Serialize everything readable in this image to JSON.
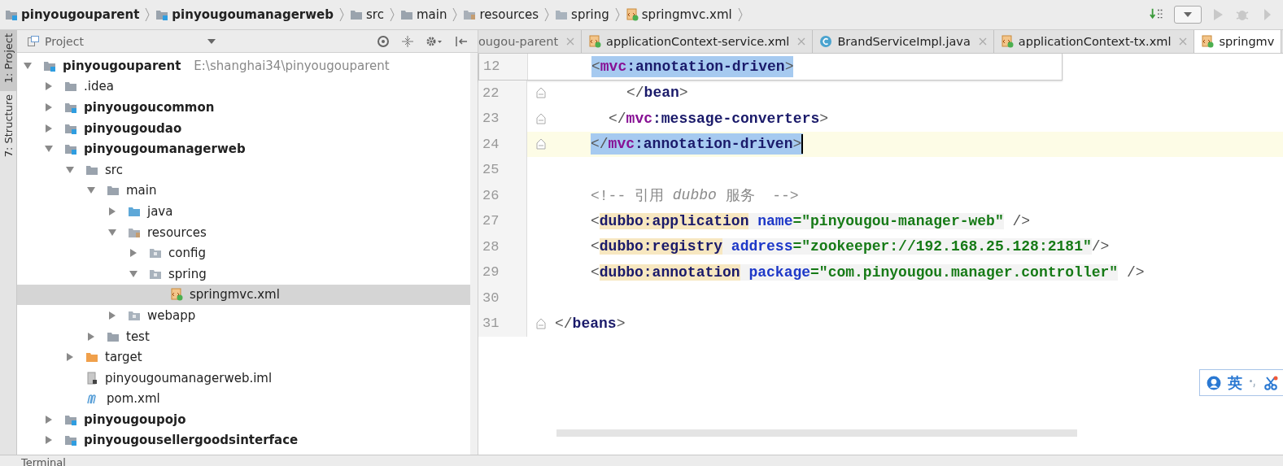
{
  "breadcrumb": [
    {
      "label": "pinyougouparent",
      "kind": "module"
    },
    {
      "label": "pinyougoumanagerweb",
      "kind": "module"
    },
    {
      "label": "src",
      "kind": "folder"
    },
    {
      "label": "main",
      "kind": "folder"
    },
    {
      "label": "resources",
      "kind": "resources"
    },
    {
      "label": "spring",
      "kind": "package"
    },
    {
      "label": "springmvc.xml",
      "kind": "xml"
    }
  ],
  "side_tabs": [
    {
      "label": "1: Project",
      "selected": true
    },
    {
      "label": "7: Structure",
      "selected": false
    }
  ],
  "project_panel": {
    "title": "Project"
  },
  "tree": [
    {
      "label": "pinyougouparent",
      "path": "E:\\shanghai34\\pinyougouparent",
      "kind": "module",
      "expanded": true,
      "selected": false,
      "children": [
        {
          "label": ".idea",
          "kind": "folder",
          "expanded": false,
          "selected": false
        },
        {
          "label": "pinyougoucommon",
          "kind": "module",
          "expanded": false,
          "selected": false
        },
        {
          "label": "pinyougoudao",
          "kind": "module",
          "expanded": false,
          "selected": false
        },
        {
          "label": "pinyougoumanagerweb",
          "kind": "module",
          "expanded": true,
          "selected": false,
          "children": [
            {
              "label": "src",
              "kind": "folder",
              "expanded": true,
              "selected": false,
              "children": [
                {
                  "label": "main",
                  "kind": "folder",
                  "expanded": true,
                  "selected": false,
                  "children": [
                    {
                      "label": "java",
                      "kind": "source",
                      "expanded": false,
                      "selected": false
                    },
                    {
                      "label": "resources",
                      "kind": "resources",
                      "expanded": true,
                      "selected": false,
                      "children": [
                        {
                          "label": "config",
                          "kind": "package",
                          "expanded": false,
                          "selected": false
                        },
                        {
                          "label": "spring",
                          "kind": "package",
                          "expanded": true,
                          "selected": false,
                          "children": [
                            {
                              "label": "springmvc.xml",
                              "kind": "xml",
                              "selected": true
                            }
                          ]
                        }
                      ]
                    },
                    {
                      "label": "webapp",
                      "kind": "web",
                      "expanded": false,
                      "selected": false
                    }
                  ]
                },
                {
                  "label": "test",
                  "kind": "folder",
                  "expanded": false,
                  "selected": false
                }
              ]
            },
            {
              "label": "target",
              "kind": "excluded",
              "expanded": false,
              "selected": false
            },
            {
              "label": "pinyougoumanagerweb.iml",
              "kind": "iml",
              "selected": false
            },
            {
              "label": "pom.xml",
              "kind": "maven",
              "selected": false
            }
          ]
        },
        {
          "label": "pinyougoupojo",
          "kind": "module",
          "expanded": false,
          "selected": false
        },
        {
          "label": "pinyougousellergoodsinterface",
          "kind": "module",
          "expanded": false,
          "selected": false
        }
      ]
    }
  ],
  "tabs": [
    {
      "label": "ougou-parent",
      "selected": false
    },
    {
      "label": "applicationContext-service.xml",
      "kind": "xml",
      "selected": false
    },
    {
      "label": "BrandServiceImpl.java",
      "kind": "class",
      "selected": false
    },
    {
      "label": "applicationContext-tx.xml",
      "kind": "xml",
      "selected": false
    },
    {
      "label": "springmv",
      "kind": "xml",
      "selected": true
    }
  ],
  "sticky_line": {
    "number": "12",
    "kind": "selection",
    "tokens": [
      {
        "text": "<",
        "kind": "bracket"
      },
      {
        "text": "mvc",
        "kind": "ns"
      },
      {
        "text": ":annotation-driven",
        "kind": "tag"
      },
      {
        "text": ">",
        "kind": "bracket"
      }
    ]
  },
  "code": [
    {
      "number": "22",
      "kind": "plain",
      "tokens": [
        {
          "text": "</",
          "kind": "bracket"
        },
        {
          "text": "bean",
          "kind": "tag"
        },
        {
          "text": ">",
          "kind": "bracket"
        }
      ]
    },
    {
      "number": "23",
      "kind": "plain",
      "tokens": [
        {
          "text": "</",
          "kind": "bracket"
        },
        {
          "text": "mvc",
          "kind": "ns"
        },
        {
          "text": ":message-converters",
          "kind": "tag"
        },
        {
          "text": ">",
          "kind": "bracket"
        }
      ]
    },
    {
      "number": "24",
      "kind": "selection-caret",
      "tokens": [
        {
          "text": "</",
          "kind": "bracket"
        },
        {
          "text": "mvc",
          "kind": "ns"
        },
        {
          "text": ":annotation-driven",
          "kind": "tag"
        },
        {
          "text": ">",
          "kind": "bracket"
        }
      ]
    },
    {
      "number": "25",
      "kind": "plain"
    },
    {
      "number": "26",
      "kind": "plain",
      "tokens": [
        {
          "text": "<!-- 引用 ",
          "kind": "comment"
        },
        {
          "text": "dubbo",
          "kind": "comment-italic"
        },
        {
          "text": " 服务  -->",
          "kind": "comment"
        }
      ]
    },
    {
      "number": "27",
      "kind": "plain",
      "tokens": [
        {
          "text": "<",
          "kind": "bracket"
        },
        {
          "text": "dubbo:application",
          "kind": "tag-match"
        },
        {
          "text": " name",
          "kind": "attr"
        },
        {
          "text": "=\"pinyougou-manager-web\"",
          "kind": "value"
        },
        {
          "text": " />",
          "kind": "bracket"
        }
      ]
    },
    {
      "number": "28",
      "kind": "plain",
      "tokens": [
        {
          "text": "<",
          "kind": "bracket"
        },
        {
          "text": "dubbo:registry",
          "kind": "tag-match"
        },
        {
          "text": " address",
          "kind": "attr"
        },
        {
          "text": "=\"zookeeper://192.168.25.128:2181\"",
          "kind": "value"
        },
        {
          "text": "/>",
          "kind": "bracket"
        }
      ]
    },
    {
      "number": "29",
      "kind": "plain",
      "tokens": [
        {
          "text": "<",
          "kind": "bracket"
        },
        {
          "text": "dubbo:annotation",
          "kind": "tag-match"
        },
        {
          "text": " package",
          "kind": "attr"
        },
        {
          "text": "=\"com.pinyougou.manager.controller\"",
          "kind": "value"
        },
        {
          "text": " />",
          "kind": "bracket"
        }
      ]
    },
    {
      "number": "30",
      "kind": "plain"
    },
    {
      "number": "31",
      "kind": "plain",
      "tokens": [
        {
          "text": "</",
          "kind": "bracket"
        },
        {
          "text": "beans",
          "kind": "tag"
        },
        {
          "text": ">",
          "kind": "bracket"
        }
      ]
    }
  ],
  "ime": {
    "label": "英"
  },
  "bottom_bar": {
    "label": "Terminal"
  }
}
